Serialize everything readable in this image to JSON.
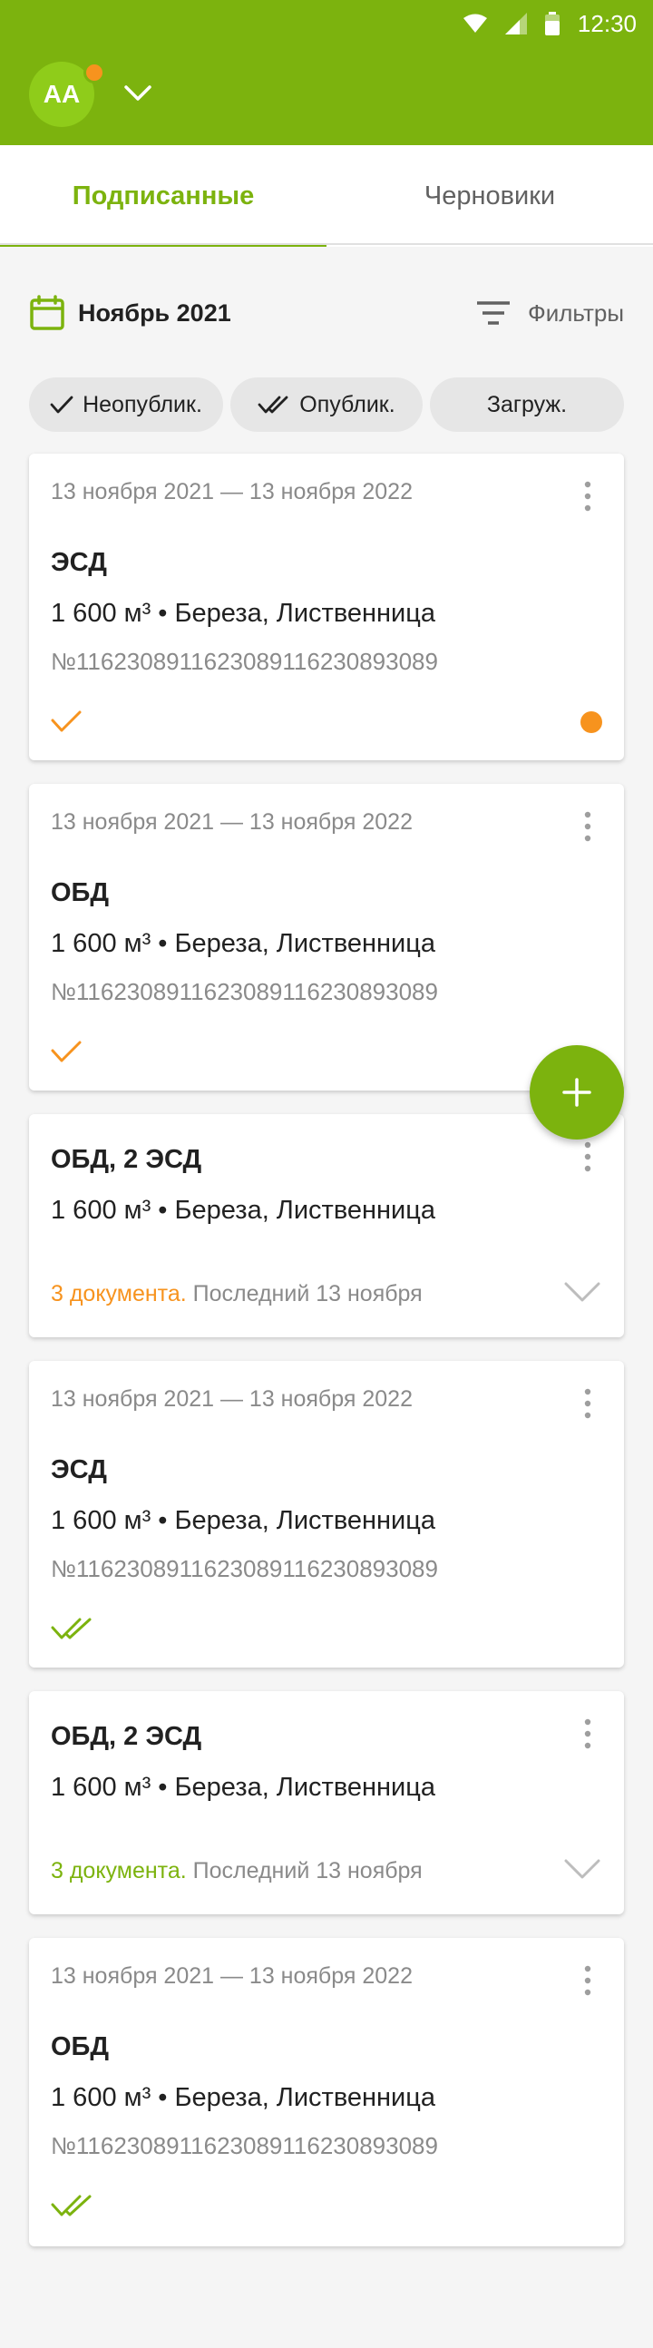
{
  "status_bar": {
    "time": "12:30"
  },
  "header": {
    "avatar_initials": "AA"
  },
  "tabs": [
    {
      "label": "Подписанные",
      "active": true
    },
    {
      "label": "Черновики",
      "active": false
    }
  ],
  "period": {
    "label": "Ноябрь 2021"
  },
  "filters": {
    "label": "Фильтры"
  },
  "chips": [
    {
      "label": "Неопублик."
    },
    {
      "label": "Опублик."
    },
    {
      "label": "Загруж."
    }
  ],
  "cards": [
    {
      "dates": "13 ноября 2021 — 13 ноября 2022",
      "type": "ЭСД",
      "volume": "1 600 м³ • Береза, Лиственница",
      "number": "№116230891162308911623089​3089",
      "status_icon": "check-orange-icon",
      "has_dot": true
    },
    {
      "dates": "13 ноября 2021 — 13 ноября 2022",
      "type": "ОБД",
      "volume": "1 600 м³ • Береза, Лиственница",
      "number": "№116230891162308911623089​3089",
      "status_icon": "check-orange-icon"
    },
    {
      "type": "ОБД, 2 ЭСД",
      "volume": "1 600 м³ • Береза, Лиственница",
      "docs_count": "3 документа.",
      "docs_last": " Последний 13 ноября"
    },
    {
      "dates": "13 ноября 2021 — 13 ноября 2022",
      "type": "ЭСД",
      "volume": "1 600 м³ • Береза, Лиственница",
      "number": "№116230891162308911623089​3089",
      "status_icon": "double-check-green-icon"
    },
    {
      "type": "ОБД, 2 ЭСД",
      "volume": "1 600 м³ • Береза, Лиственница",
      "docs_count": "3 документа.",
      "docs_last": " Последний 13 ноября"
    },
    {
      "dates": "13 ноября 2021 — 13 ноября 2022",
      "type": "ОБД",
      "volume": "1 600 м³ • Береза, Лиственница",
      "number": "№116230891162308911623089​3089",
      "status_icon": "double-check-green-icon"
    }
  ],
  "colors": {
    "primary": "#7cb30e",
    "accent": "#f7931e",
    "text_secondary": "#8a8a8a"
  }
}
